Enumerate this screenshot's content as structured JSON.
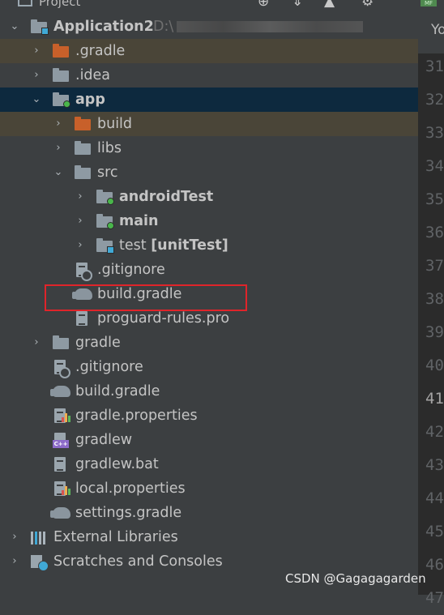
{
  "header": {
    "title": "Project",
    "icons": [
      "globe-icon",
      "collapse-icon",
      "scroll-icon",
      "gear-icon"
    ]
  },
  "tree": {
    "root": {
      "label": "Application2",
      "path_prefix": "D:\\"
    },
    "rows": [
      {
        "label": ".gradle"
      },
      {
        "label": ".idea"
      },
      {
        "label": "app"
      },
      {
        "label": "build"
      },
      {
        "label": "libs"
      },
      {
        "label": "src"
      },
      {
        "label": "androidTest"
      },
      {
        "label": "main"
      },
      {
        "label": "test",
        "suffix": "[unitTest]"
      },
      {
        "label": ".gitignore"
      },
      {
        "label": "build.gradle"
      },
      {
        "label": "proguard-rules.pro"
      },
      {
        "label": "gradle"
      },
      {
        "label": ".gitignore"
      },
      {
        "label": "build.gradle"
      },
      {
        "label": "gradle.properties"
      },
      {
        "label": "gradlew"
      },
      {
        "label": "gradlew.bat"
      },
      {
        "label": "local.properties"
      },
      {
        "label": "settings.gradle"
      },
      {
        "label": "External Libraries"
      },
      {
        "label": "Scratches and Consoles"
      }
    ]
  },
  "editor": {
    "badge": "MF",
    "tab_label": "Yo",
    "line_numbers": [
      "31",
      "32",
      "33",
      "34",
      "35",
      "36",
      "37",
      "38",
      "39",
      "40",
      "41",
      "42",
      "43",
      "44",
      "45",
      "46",
      "47"
    ]
  },
  "watermark": "CSDN @Gagagagarden",
  "colors": {
    "background": "#3c3f41",
    "selection": "#0d293e",
    "excluded_highlight": "#4a4538",
    "highlight_box": "#e0242a"
  }
}
